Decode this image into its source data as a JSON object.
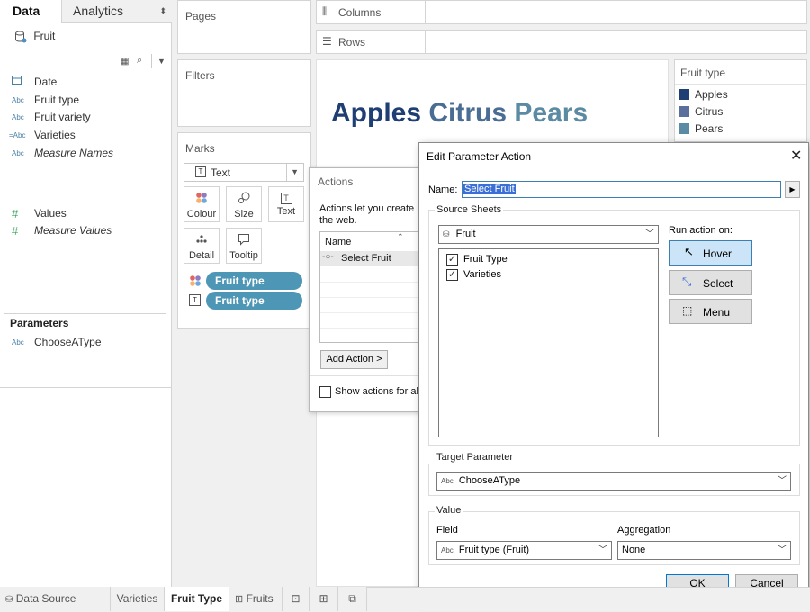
{
  "left_pane": {
    "tab_data": "Data",
    "tab_analytics": "Analytics",
    "datasource": "Fruit",
    "dimensions": [
      {
        "icon": "calendar-icon",
        "label": "Date"
      },
      {
        "icon": "Abc",
        "label": "Fruit type"
      },
      {
        "icon": "Abc",
        "label": "Fruit variety"
      },
      {
        "icon": "Abc",
        "label": "Varieties"
      },
      {
        "icon": "Abc",
        "label": "Measure Names"
      }
    ],
    "measures": [
      {
        "icon": "#",
        "label": "Values"
      },
      {
        "icon": "#",
        "label": "Measure Values"
      }
    ],
    "parameters_title": "Parameters",
    "parameters": [
      {
        "icon": "Abc",
        "label": "ChooseAType"
      }
    ]
  },
  "shelves": {
    "pages": "Pages",
    "filters": "Filters",
    "columns": "Columns",
    "rows": "Rows"
  },
  "marks": {
    "title": "Marks",
    "type": "Text",
    "buttons": [
      "Colour",
      "Size",
      "Text",
      "Detail",
      "Tooltip"
    ],
    "pills": [
      "Fruit type",
      "Fruit type"
    ]
  },
  "canvas": {
    "words": [
      {
        "text": "Apples",
        "color": "#1f3f74"
      },
      {
        "text": "Citrus",
        "color": "#4a6d94"
      },
      {
        "text": "Pears",
        "color": "#5b8aa3"
      }
    ]
  },
  "legend": {
    "title": "Fruit type",
    "items": [
      {
        "label": "Apples",
        "color": "#1f3f74"
      },
      {
        "label": "Citrus",
        "color": "#5a6f9c"
      },
      {
        "label": "Pears",
        "color": "#5b8aa3"
      }
    ]
  },
  "actions_dialog": {
    "title": "Actions",
    "description_line1": "Actions let you create i",
    "description_line2": "the web.",
    "column_name": "Name",
    "rows": [
      "Select Fruit"
    ],
    "add_action": "Add Action >",
    "show_actions": "Show actions for all"
  },
  "param_dialog": {
    "title": "Edit Parameter Action",
    "name_label": "Name:",
    "name_value": "Select Fruit",
    "source_sheets_label": "Source Sheets",
    "source_value": "Fruit",
    "sheets": [
      {
        "label": "Fruit Type",
        "checked": true
      },
      {
        "label": "Varieties",
        "checked": true
      }
    ],
    "run_action_label": "Run action on:",
    "run_buttons": [
      "Hover",
      "Select",
      "Menu"
    ],
    "target_param_label": "Target Parameter",
    "target_param_value": "ChooseAType",
    "value_label": "Value",
    "field_label": "Field",
    "field_value": "Fruit type (Fruit)",
    "aggregation_label": "Aggregation",
    "aggregation_value": "None",
    "ok": "OK",
    "cancel": "Cancel"
  },
  "bottom_tabs": [
    "Data Source",
    "Varieties",
    "Fruit Type",
    "Fruits"
  ]
}
